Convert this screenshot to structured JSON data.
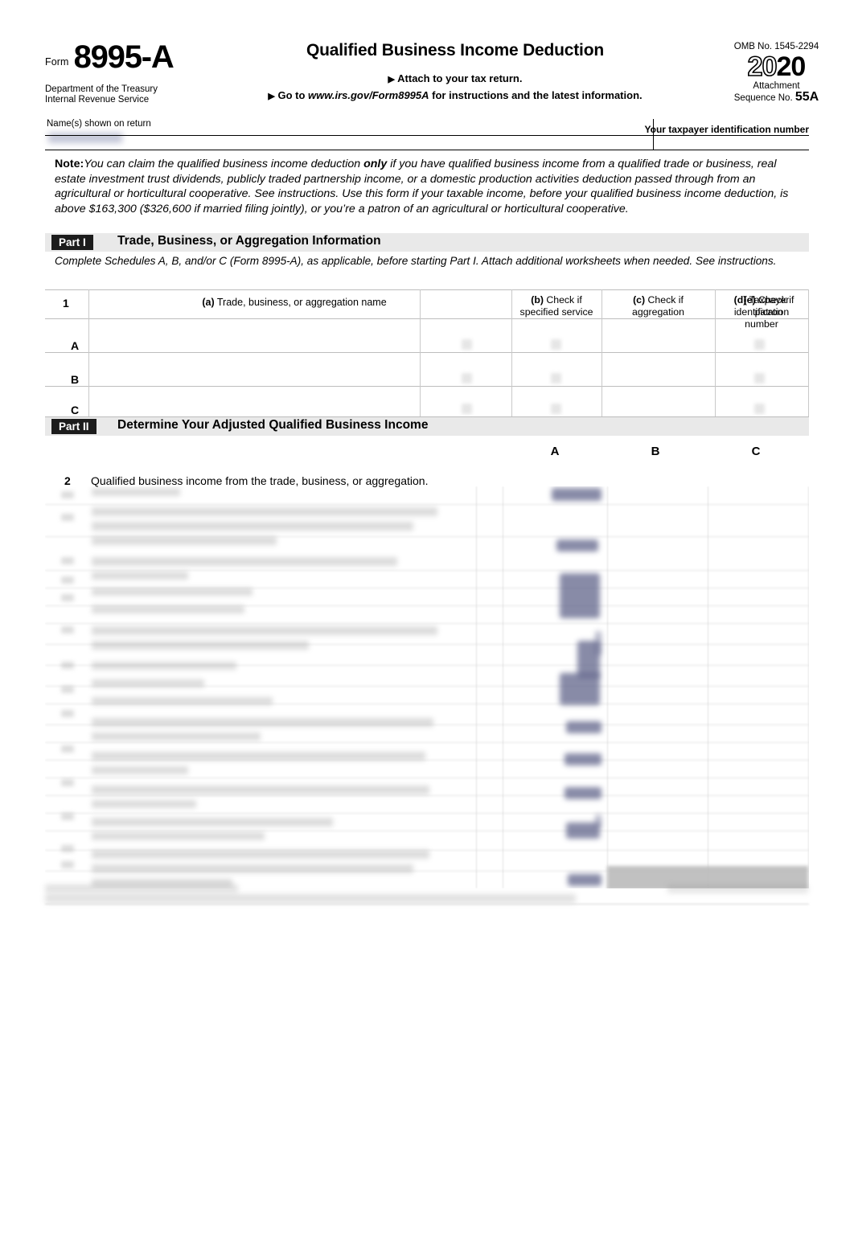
{
  "form": {
    "form_word": "Form",
    "number": "8995-A",
    "department_line1": "Department of the Treasury",
    "department_line2": "Internal Revenue Service",
    "name_label": "Name(s) shown on return",
    "name_value": "",
    "tin_label": "Your taxpayer identification number",
    "title": "Qualified Business Income Deduction",
    "attach_arrow": "▶",
    "attach_text": "Attach to your tax return.",
    "goto_prefix": "Go to",
    "goto_url": "www.irs.gov/Form8995A",
    "goto_suffix": "for instructions and the latest information.",
    "omb": "OMB No. 1545-2294",
    "year_hollow": "20",
    "year_solid": "20",
    "attachment_label_line1": "Attachment",
    "attachment_label_line2": "Sequence No.",
    "attachment_number": "55A"
  },
  "note": {
    "label": "Note:",
    "text_1": "You can claim the qualified business income deduction ",
    "emph": "only",
    "text_2": " if you have qualified business income from a qualified trade or business, real estate investment trust dividends, publicly traded partnership income, or a domestic production activities deduction passed through from an agricultural or horticultural cooperative. See instructions. Use this form if your taxable income, before your qualified business income deduction, is above $163,300 ($326,600 if married filing jointly), or you’re a patron of an agricultural or horticultural cooperative."
  },
  "part1": {
    "badge": "Part I",
    "title": "Trade, Business, or Aggregation Information",
    "subnote": "Complete Schedules A, B, and/or C (Form 8995-A), as applicable, before starting Part I. Attach additional worksheets when needed. See instructions.",
    "line_number": "1",
    "columns": [
      {
        "key": "a",
        "tag": "(a)",
        "label": "Trade, business, or aggregation name"
      },
      {
        "key": "b",
        "tag": "(b)",
        "label_line1": "Check if",
        "label_line2": "specified service"
      },
      {
        "key": "c",
        "tag": "(c)",
        "label_line1": "Check if",
        "label_line2": "aggregation"
      },
      {
        "key": "d",
        "tag": "(d)",
        "label_line1": "Taxpayer",
        "label_line2": "identification number"
      },
      {
        "key": "e",
        "tag": "(e)",
        "label_line1": "Check if",
        "label_line2": "patron"
      }
    ],
    "rows": [
      {
        "label": "A",
        "name": "",
        "specified_service": "",
        "aggregation": "",
        "tin": "",
        "patron": ""
      },
      {
        "label": "B",
        "name": "",
        "specified_service": "",
        "aggregation": "",
        "tin": "",
        "patron": ""
      },
      {
        "label": "C",
        "name": "",
        "specified_service": "",
        "aggregation": "",
        "tin": "",
        "patron": ""
      }
    ]
  },
  "part2": {
    "badge": "Part II",
    "title": "Determine Your Adjusted Qualified Business Income",
    "column_headers": [
      "A",
      "B",
      "C"
    ],
    "lines": [
      {
        "number": "2",
        "text": "Qualified business income from the trade, business, or aggregation.",
        "a": "",
        "b": "",
        "c": ""
      }
    ]
  },
  "colors": {
    "part_bar_background": "#e9e9e9",
    "badge_background": "#1c1c1c",
    "badge_text": "#ffffff",
    "redaction_value": "#5b5f86",
    "shaded_cell": "#bcbcbc",
    "rule": "#bdbdbd"
  }
}
